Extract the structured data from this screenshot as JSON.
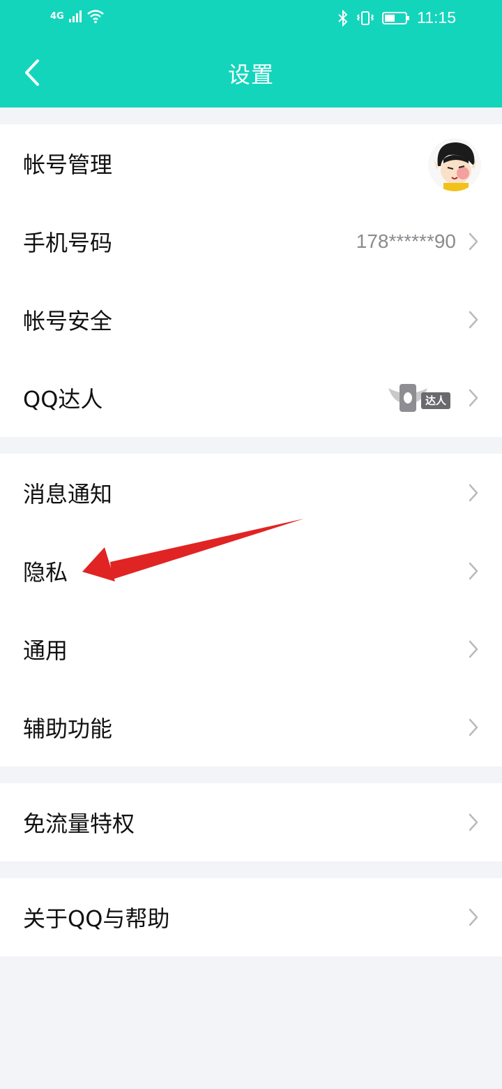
{
  "status_bar": {
    "network": "4G",
    "time": "11:15"
  },
  "nav": {
    "title": "设置",
    "back_icon": "chevron-left-icon"
  },
  "groups": [
    {
      "items": [
        {
          "label": "帐号管理",
          "avatar": true
        },
        {
          "label": "手机号码",
          "value": "178******90"
        },
        {
          "label": "帐号安全"
        },
        {
          "label": "QQ达人",
          "badge": "达人"
        }
      ]
    },
    {
      "items": [
        {
          "label": "消息通知"
        },
        {
          "label": "隐私"
        },
        {
          "label": "通用"
        },
        {
          "label": "辅助功能"
        }
      ]
    },
    {
      "items": [
        {
          "label": "免流量特权"
        }
      ]
    },
    {
      "items": [
        {
          "label": "关于QQ与帮助"
        }
      ]
    }
  ],
  "colors": {
    "header_bg": "#13d5bc",
    "page_bg": "#f3f4f8",
    "annotation_arrow": "#e02424"
  }
}
